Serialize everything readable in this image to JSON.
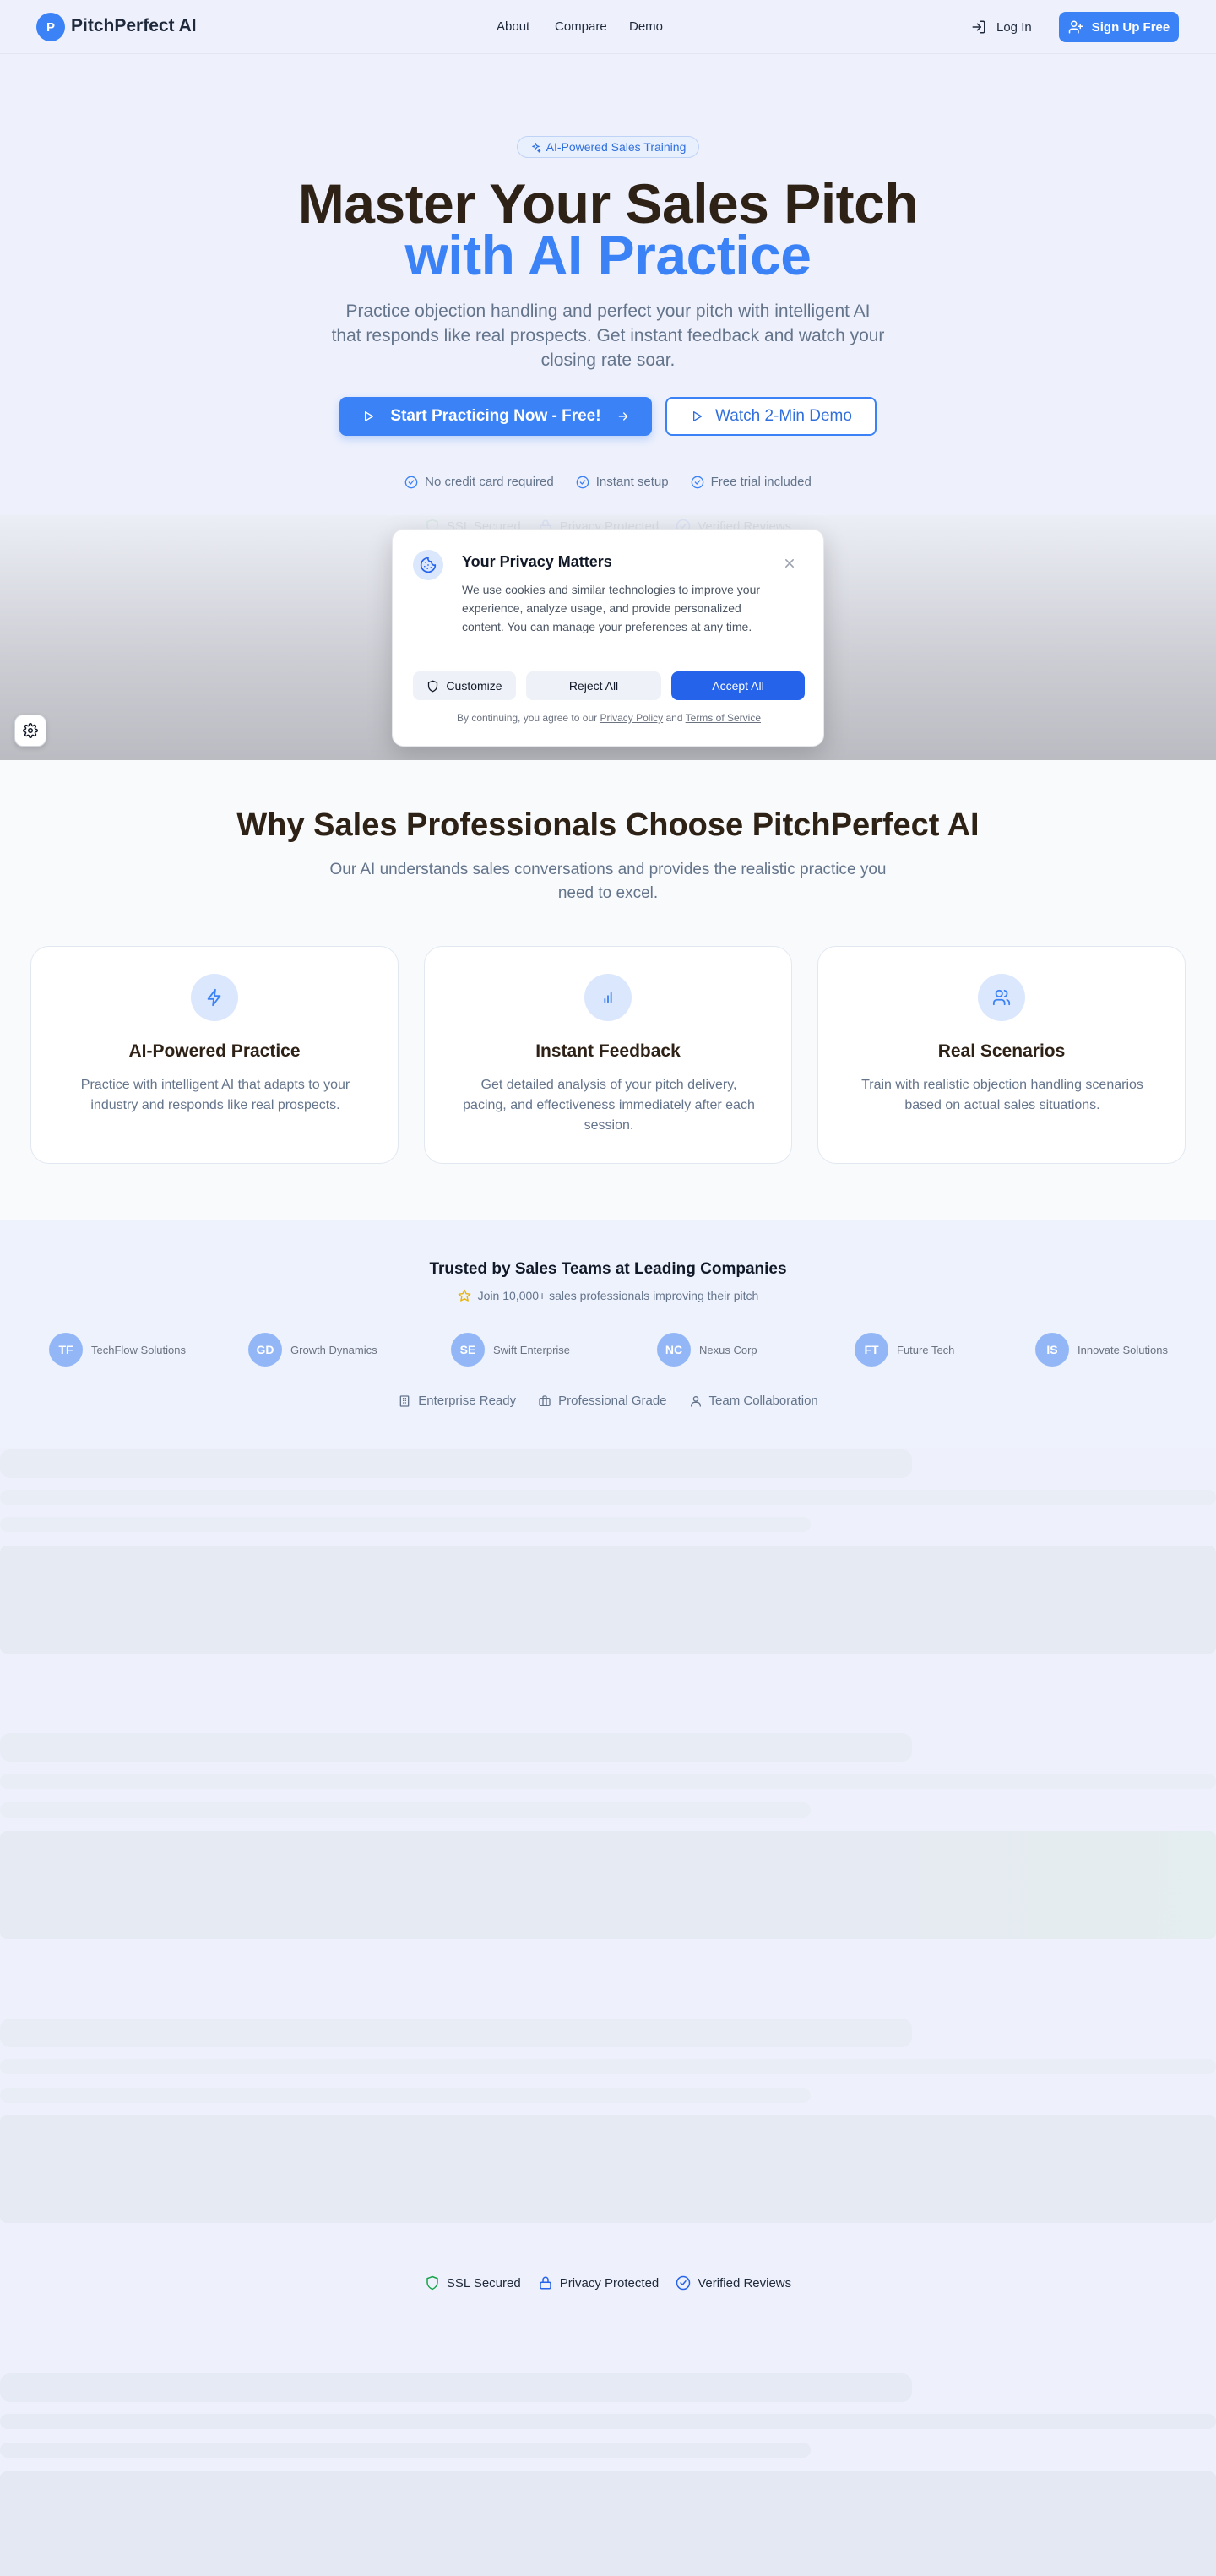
{
  "nav": {
    "logo_letter": "P",
    "brand": "PitchPerfect AI",
    "links": [
      "About",
      "Compare",
      "Demo"
    ],
    "login": "Log In",
    "signup": "Sign Up Free"
  },
  "hero": {
    "badge": "AI-Powered Sales Training",
    "title_line1": "Master Your Sales Pitch",
    "title_line2": "with AI Practice",
    "subtitle": "Practice objection handling and perfect your pitch with intelligent AI that responds like real prospects. Get instant feedback and watch your closing rate soar.",
    "cta_primary": "Start Practicing Now - Free!",
    "cta_secondary": "Watch 2-Min Demo",
    "checks": [
      "No credit card required",
      "Instant setup",
      "Free trial included"
    ]
  },
  "trust_badges": [
    "SSL Secured",
    "Privacy Protected",
    "Verified Reviews"
  ],
  "cookie": {
    "title": "Your Privacy Matters",
    "body": "We use cookies and similar technologies to improve your experience, analyze usage, and provide personalized content. You can manage your preferences at any time.",
    "customize": "Customize",
    "reject": "Reject All",
    "accept": "Accept All",
    "footer_prefix": "By continuing, you agree to our",
    "privacy_link": "Privacy Policy",
    "and": "and",
    "terms_link": "Terms of Service"
  },
  "why": {
    "title": "Why Sales Professionals Choose PitchPerfect AI",
    "subtitle": "Our AI understands sales conversations and provides the realistic practice you need to excel.",
    "cards": [
      {
        "icon": "lightning-icon",
        "title": "AI-Powered Practice",
        "text": "Practice with intelligent AI that adapts to your industry and responds like real prospects."
      },
      {
        "icon": "bar-chart-icon",
        "title": "Instant Feedback",
        "text": "Get detailed analysis of your pitch delivery, pacing, and effectiveness immediately after each session."
      },
      {
        "icon": "users-icon",
        "title": "Real Scenarios",
        "text": "Train with realistic objection handling scenarios based on actual sales situations."
      }
    ]
  },
  "trusted": {
    "title": "Trusted by Sales Teams at Leading Companies",
    "subtitle": "Join 10,000+ sales professionals improving their pitch",
    "companies": [
      {
        "initials": "TF",
        "name": "TechFlow Solutions"
      },
      {
        "initials": "GD",
        "name": "Growth Dynamics"
      },
      {
        "initials": "SE",
        "name": "Swift Enterprise"
      },
      {
        "initials": "NC",
        "name": "Nexus Corp"
      },
      {
        "initials": "FT",
        "name": "Future Tech"
      },
      {
        "initials": "IS",
        "name": "Innovate Solutions"
      }
    ],
    "features": [
      "Enterprise Ready",
      "Professional Grade",
      "Team Collaboration"
    ]
  },
  "colors": {
    "accent": "#3b82f6",
    "accent_dark": "#2563eb",
    "heading": "#2e2116",
    "muted": "#64748b"
  }
}
